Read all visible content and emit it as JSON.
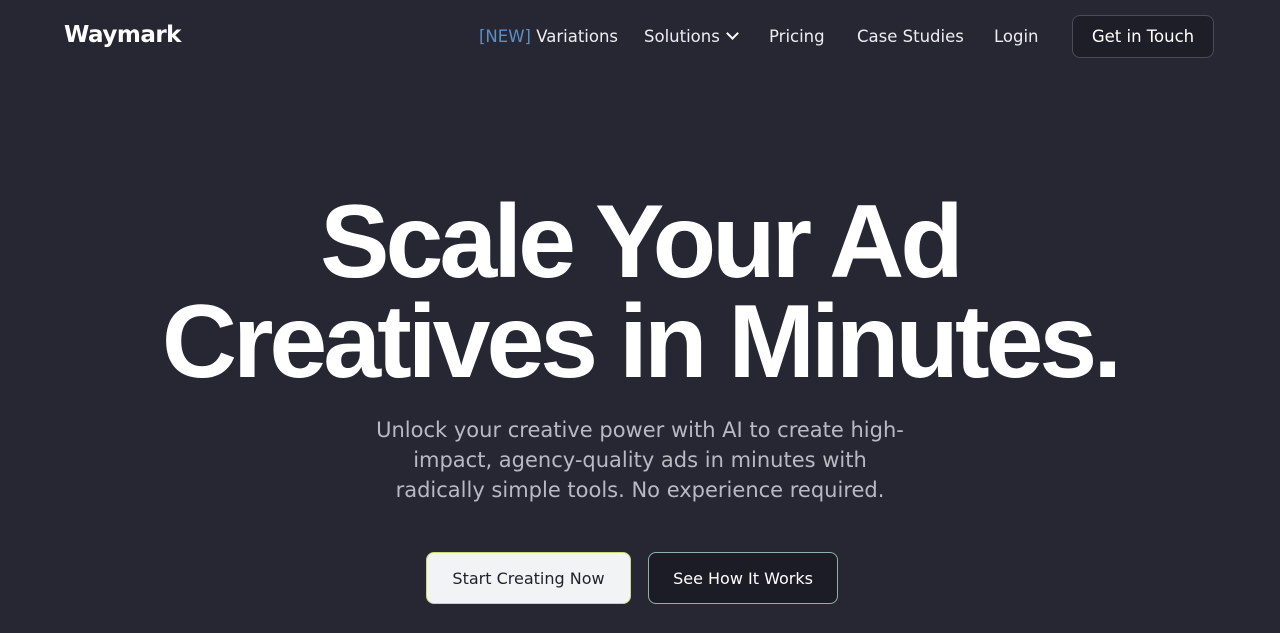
{
  "header": {
    "logo": "Waymark",
    "nav": {
      "new_tag": "[NEW]",
      "variations": "Variations",
      "solutions": "Solutions",
      "pricing": "Pricing",
      "case_studies": "Case Studies",
      "login": "Login"
    },
    "cta_label": "Get in Touch"
  },
  "hero": {
    "title_line1": "Scale Your Ad",
    "title_line2": "Creatives in Minutes.",
    "subtitle_line1": "Unlock your creative power with AI to create high-",
    "subtitle_line2": "impact, agency-quality ads in minutes with",
    "subtitle_line3": "radically simple tools. No experience required.",
    "primary_button": "Start Creating Now",
    "secondary_button": "See How It Works"
  },
  "colors": {
    "background": "#272733",
    "new_tag": "#5d8ec4",
    "primary_button_bg": "#f1f3f5"
  }
}
